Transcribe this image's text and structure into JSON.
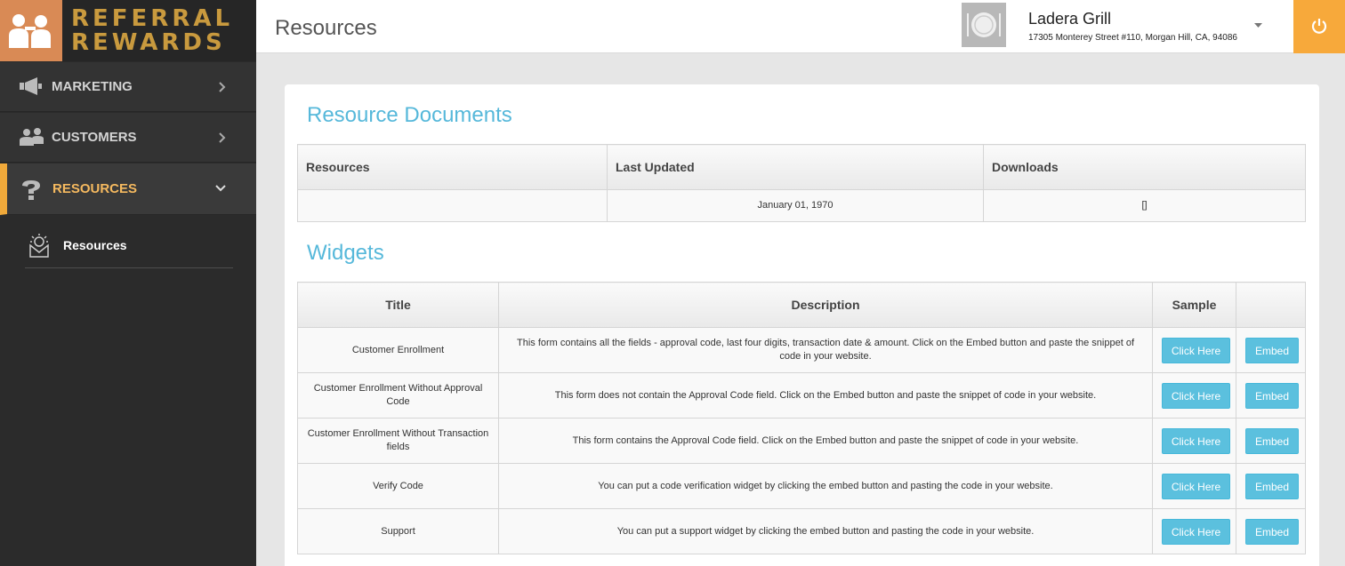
{
  "brand": {
    "line1": "REFERRAL",
    "line2": "REWARDS"
  },
  "sidebar": {
    "items": [
      {
        "label": "MARKETING",
        "icon": "megaphone-icon"
      },
      {
        "label": "CUSTOMERS",
        "icon": "users-icon"
      },
      {
        "label": "RESOURCES",
        "icon": "question-icon",
        "active": true
      }
    ],
    "sub_items": [
      {
        "label": "Resources",
        "icon": "lightbulb-icon"
      }
    ]
  },
  "header": {
    "title": "Resources",
    "venue_name": "Ladera Grill",
    "venue_address": "17305 Monterey Street #110, Morgan Hill, CA, 94086"
  },
  "documents": {
    "title": "Resource Documents",
    "columns": [
      "Resources",
      "Last Updated",
      "Downloads"
    ],
    "rows": [
      {
        "resource": "",
        "last_updated": "January 01, 1970",
        "downloads": "[]"
      }
    ]
  },
  "widgets": {
    "title": "Widgets",
    "columns": [
      "Title",
      "Description",
      "Sample",
      ""
    ],
    "sample_label": "Click Here",
    "embed_label": "Embed",
    "rows": [
      {
        "title": "Customer Enrollment",
        "description": "This form contains all the fields - approval code, last four digits, transaction date & amount. Click on the Embed button and paste the snippet of code in your website."
      },
      {
        "title": "Customer Enrollment Without Approval Code",
        "description": "This form does not contain the Approval Code field. Click on the Embed button and paste the snippet of code in your website."
      },
      {
        "title": "Customer Enrollment Without Transaction fields",
        "description": "This form contains the Approval Code field. Click on the Embed button and paste the snippet of code in your website."
      },
      {
        "title": "Verify Code",
        "description": "You can put a code verification widget by clicking the embed button and pasting the code in your website."
      },
      {
        "title": "Support",
        "description": "You can put a support widget by clicking the embed button and pasting the code in your website."
      }
    ]
  },
  "colors": {
    "accent": "#5bc0de",
    "title_blue": "#56b8da",
    "active_nav": "#f0a93a",
    "power": "#f7a93b",
    "sidebar": "#2b2b2b"
  }
}
